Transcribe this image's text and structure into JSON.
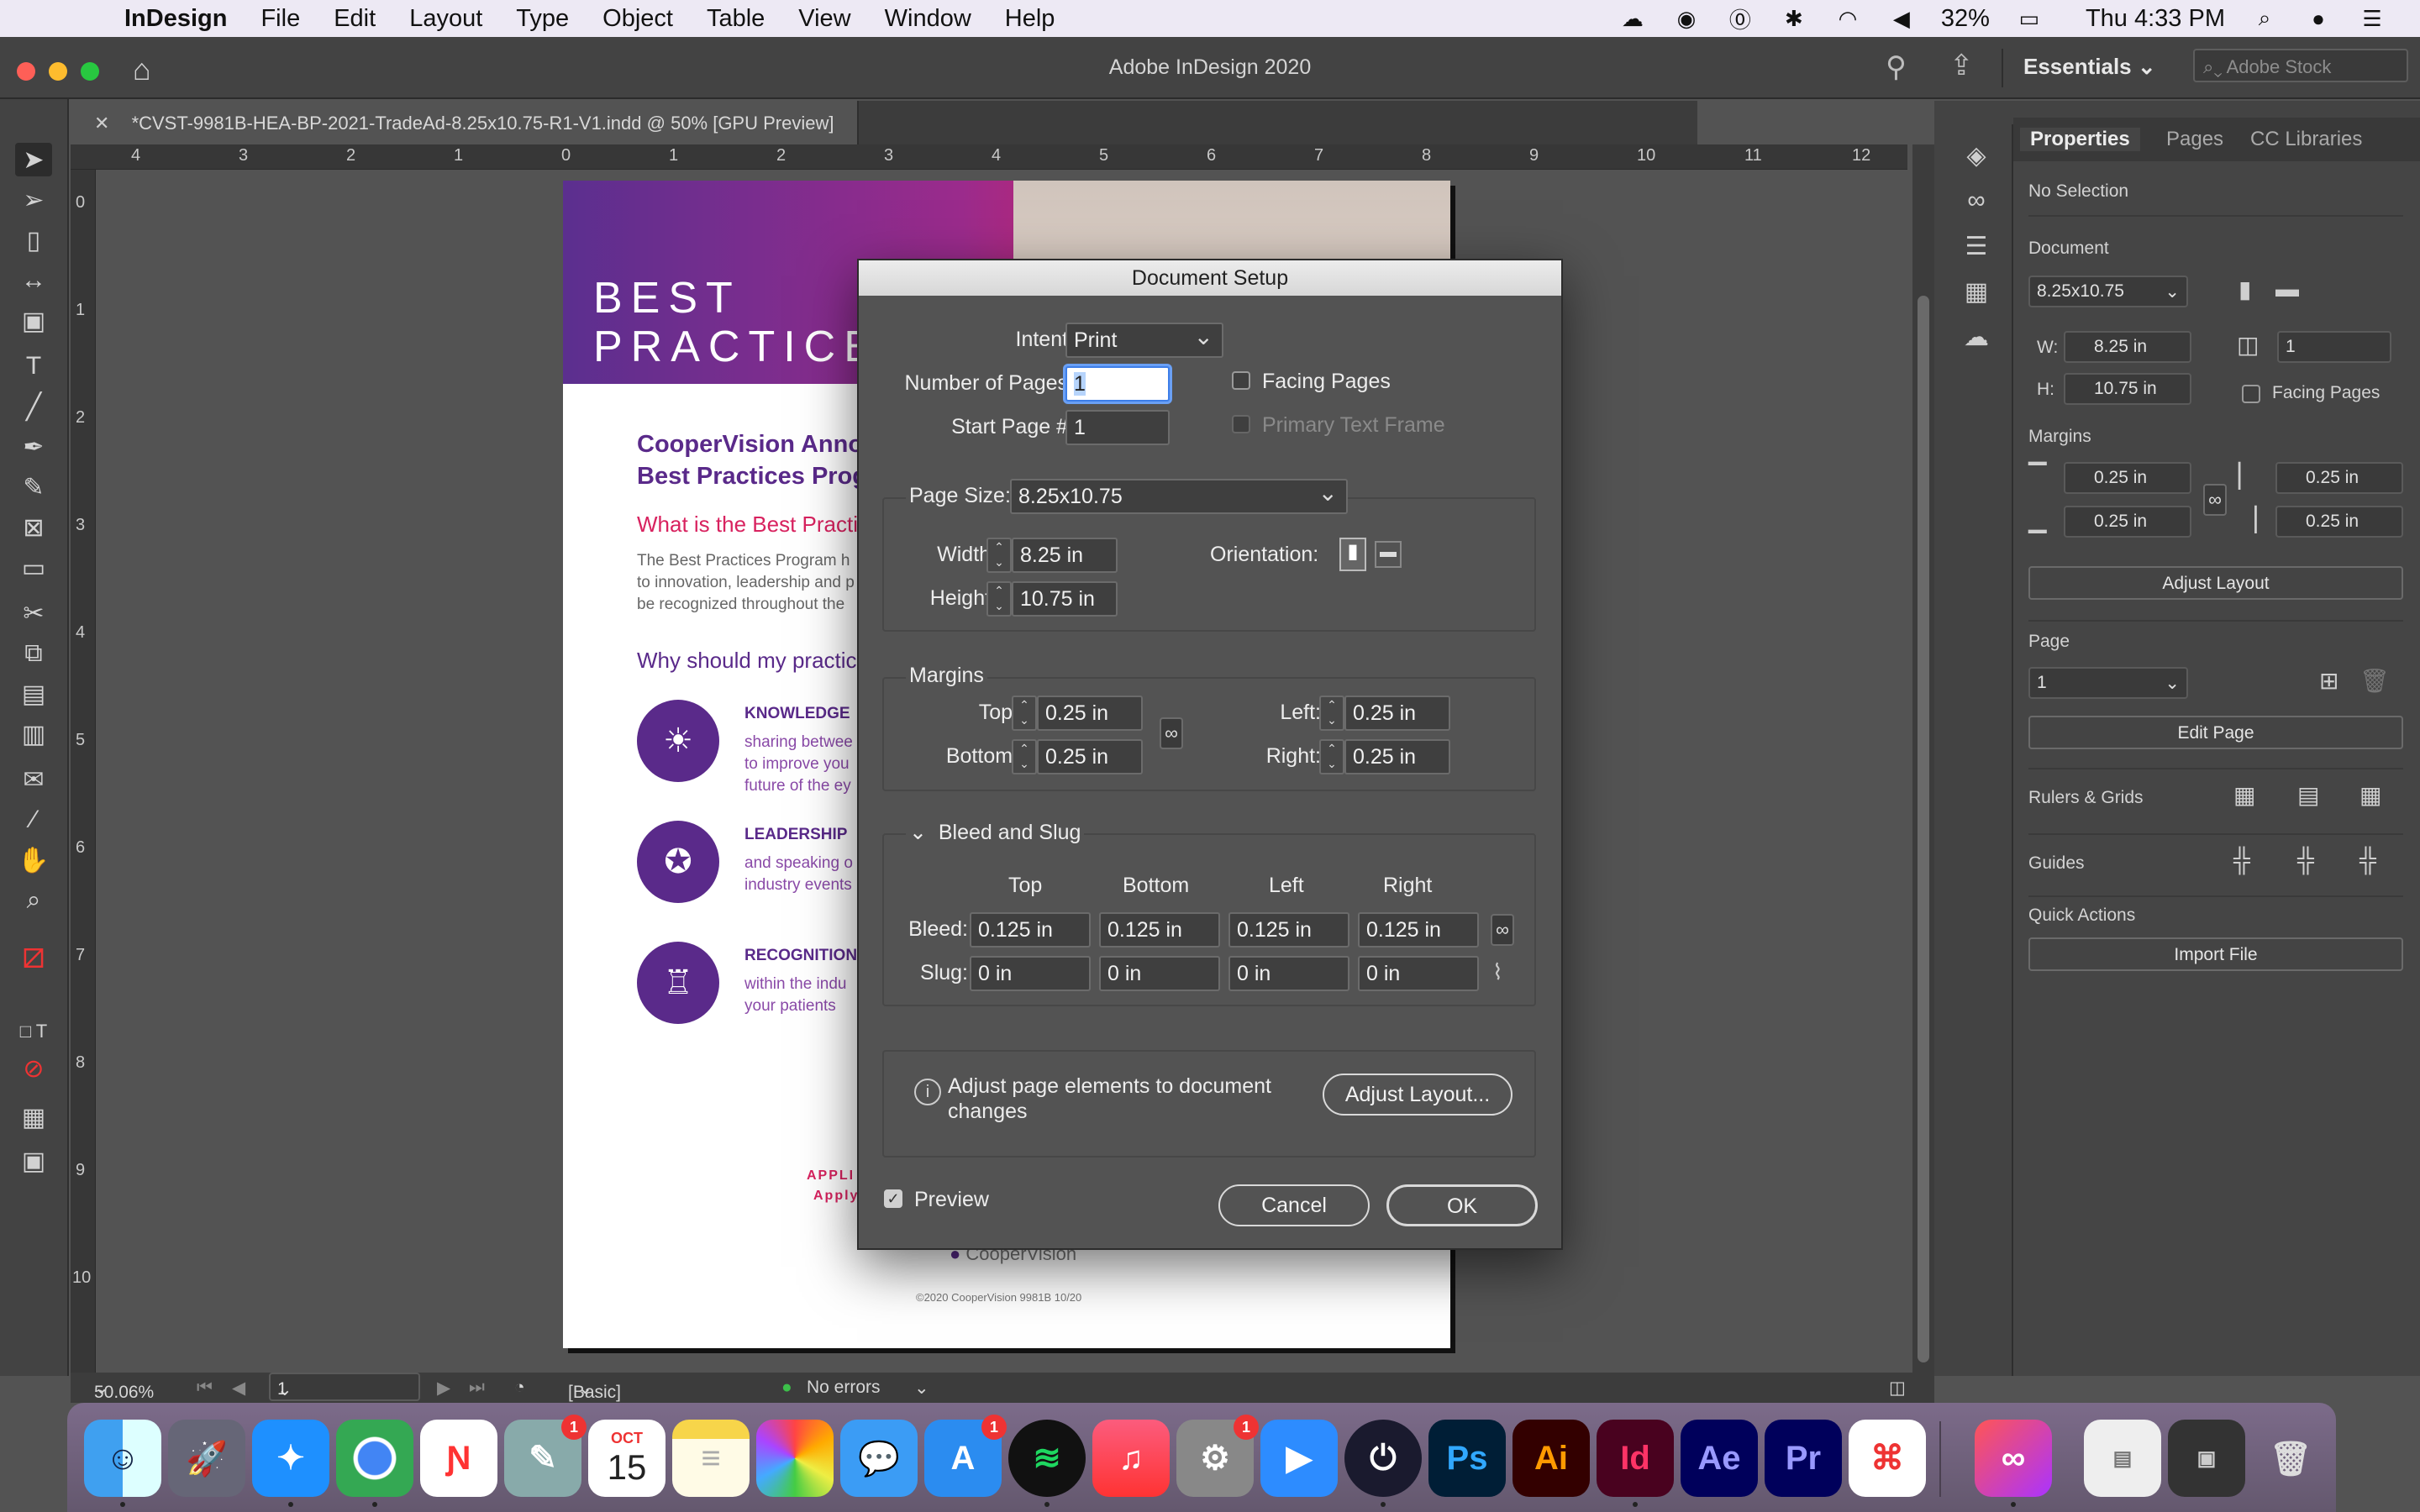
{
  "menubar": {
    "app": "InDesign",
    "items": [
      "File",
      "Edit",
      "Layout",
      "Type",
      "Object",
      "Table",
      "View",
      "Window",
      "Help"
    ],
    "battery": "32%",
    "clock": "Thu 4:33 PM"
  },
  "appbar": {
    "title": "Adobe InDesign 2020",
    "workspace": "Essentials",
    "stock_placeholder": "Adobe Stock"
  },
  "document": {
    "tab_title": "*CVST-9981B-HEA-BP-2021-TradeAd-8.25x10.75-R1-V1.indd @ 50% [GPU Preview]",
    "ruler_h": [
      "4",
      "3",
      "2",
      "1",
      "0",
      "1",
      "2",
      "3",
      "4",
      "5",
      "6",
      "7",
      "8",
      "9",
      "10",
      "11",
      "12"
    ],
    "ruler_v": [
      "0",
      "1",
      "2",
      "3",
      "4",
      "5",
      "6",
      "7",
      "8",
      "9",
      "10"
    ]
  },
  "page": {
    "banner_line1": "BEST",
    "banner_line2": "PRACTICES",
    "heading_line1": "CooperVision Anno",
    "heading_line2": "Best Practices Prog",
    "question": "What is the Best Practic",
    "body_line1": "The Best Practices Program h",
    "body_line2": "to innovation, leadership and p",
    "body_line3": "be recognized throughout the",
    "why": "Why should my practic",
    "items": [
      {
        "label": "KNOWLEDGE",
        "text1": "sharing betwee",
        "text2": "to improve you",
        "text3": "future of the ey"
      },
      {
        "label": "LEADERSHIP",
        "text1": "and speaking o",
        "text2": "industry events",
        "text3": ""
      },
      {
        "label": "RECOGNITION",
        "text1": "within the indu",
        "text2": "your patients",
        "text3": ""
      }
    ],
    "apply1": "APPLI",
    "apply2": "Apply",
    "logo": "CooperVision",
    "copyright": "©2020 CooperVision 9981B 10/20"
  },
  "dialog": {
    "title": "Document Setup",
    "intent_label": "Intent:",
    "intent_value": "Print",
    "pages_label": "Number of Pages:",
    "pages_value": "1",
    "start_label": "Start Page #:",
    "start_value": "1",
    "facing_pages": "Facing Pages",
    "primary_text_frame": "Primary Text Frame",
    "page_size_label": "Page Size:",
    "page_size_value": "8.25x10.75",
    "width_label": "Width:",
    "width_value": "8.25 in",
    "height_label": "Height:",
    "height_value": "10.75 in",
    "orientation_label": "Orientation:",
    "margins_label": "Margins",
    "top_label": "Top:",
    "top_value": "0.25 in",
    "bottom_label": "Bottom:",
    "bottom_value": "0.25 in",
    "left_label": "Left:",
    "left_value": "0.25 in",
    "right_label": "Right:",
    "right_value": "0.25 in",
    "bleed_slug_label": "Bleed and Slug",
    "col_top": "Top",
    "col_bottom": "Bottom",
    "col_left": "Left",
    "col_right": "Right",
    "bleed_label": "Bleed:",
    "bleed_values": [
      "0.125 in",
      "0.125 in",
      "0.125 in",
      "0.125 in"
    ],
    "slug_label": "Slug:",
    "slug_values": [
      "0 in",
      "0 in",
      "0 in",
      "0 in"
    ],
    "adjust_info": "Adjust page elements to document changes",
    "adjust_button": "Adjust Layout...",
    "preview_label": "Preview",
    "cancel": "Cancel",
    "ok": "OK"
  },
  "panel": {
    "tabs": [
      "Properties",
      "Pages",
      "CC Libraries"
    ],
    "no_selection": "No Selection",
    "document_label": "Document",
    "doc_size": "8.25x10.75",
    "w_label": "W:",
    "w_value": "8.25 in",
    "h_label": "H:",
    "h_value": "10.75 in",
    "pages_value": "1",
    "facing_pages": "Facing Pages",
    "margins_label": "Margins",
    "margin_values": [
      "0.25 in",
      "0.25 in",
      "0.25 in",
      "0.25 in"
    ],
    "adjust_layout": "Adjust Layout",
    "page_label": "Page",
    "page_value": "1",
    "edit_page": "Edit Page",
    "rulers_grids": "Rulers & Grids",
    "guides": "Guides",
    "quick_actions": "Quick Actions",
    "import_file": "Import File"
  },
  "statusbar": {
    "zoom": "50.06%",
    "page": "1",
    "preflight_profile": "[Basic] (working)",
    "errors": "No errors"
  },
  "dock": {
    "calendar_month": "OCT",
    "calendar_day": "15",
    "badges": [
      "1",
      "1",
      "1"
    ],
    "apps": [
      "Ps",
      "Ai",
      "Id",
      "Ae",
      "Pr"
    ]
  },
  "colors": {
    "brand_purple": "#5a2a8a",
    "brand_pink": "#d8225f",
    "ps": "#31a8ff",
    "ai": "#ff9a00",
    "id": "#ff3366",
    "ae": "#9999ff",
    "pr": "#9999ff"
  }
}
